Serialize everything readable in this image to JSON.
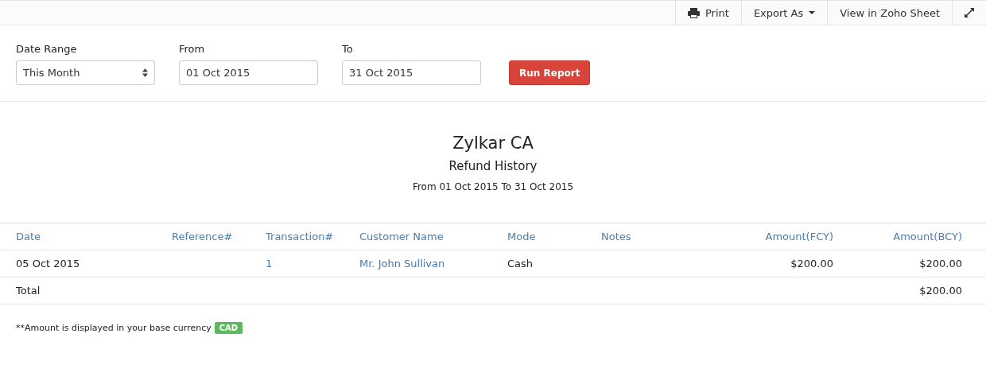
{
  "toolbar": {
    "print": "Print",
    "export": "Export As",
    "sheet": "View in Zoho Sheet"
  },
  "filters": {
    "date_range": {
      "label": "Date Range",
      "value": "This Month"
    },
    "from": {
      "label": "From",
      "value": "01 Oct 2015"
    },
    "to": {
      "label": "To",
      "value": "31 Oct 2015"
    },
    "run_button": "Run Report"
  },
  "report": {
    "organization": "Zylkar CA",
    "title": "Refund History",
    "period": "From 01 Oct 2015 To 31 Oct 2015"
  },
  "table": {
    "columns": [
      "Date",
      "Reference#",
      "Transaction#",
      "Customer Name",
      "Mode",
      "Notes",
      "Amount(FCY)",
      "Amount(BCY)"
    ],
    "rows": [
      {
        "cells": [
          {
            "text": "05 Oct 2015",
            "kind": "text"
          },
          null,
          {
            "text": "1",
            "kind": "link"
          },
          {
            "text": "Mr. John Sullivan",
            "kind": "link"
          },
          {
            "text": "Cash",
            "kind": "text"
          },
          null,
          {
            "text": "$200.00",
            "kind": "text"
          },
          {
            "text": "$200.00",
            "kind": "text"
          }
        ]
      }
    ],
    "total": {
      "label": "Total",
      "amount": "$200.00"
    }
  },
  "footnote": {
    "text": "**Amount is displayed in your base currency",
    "currency": "CAD"
  }
}
